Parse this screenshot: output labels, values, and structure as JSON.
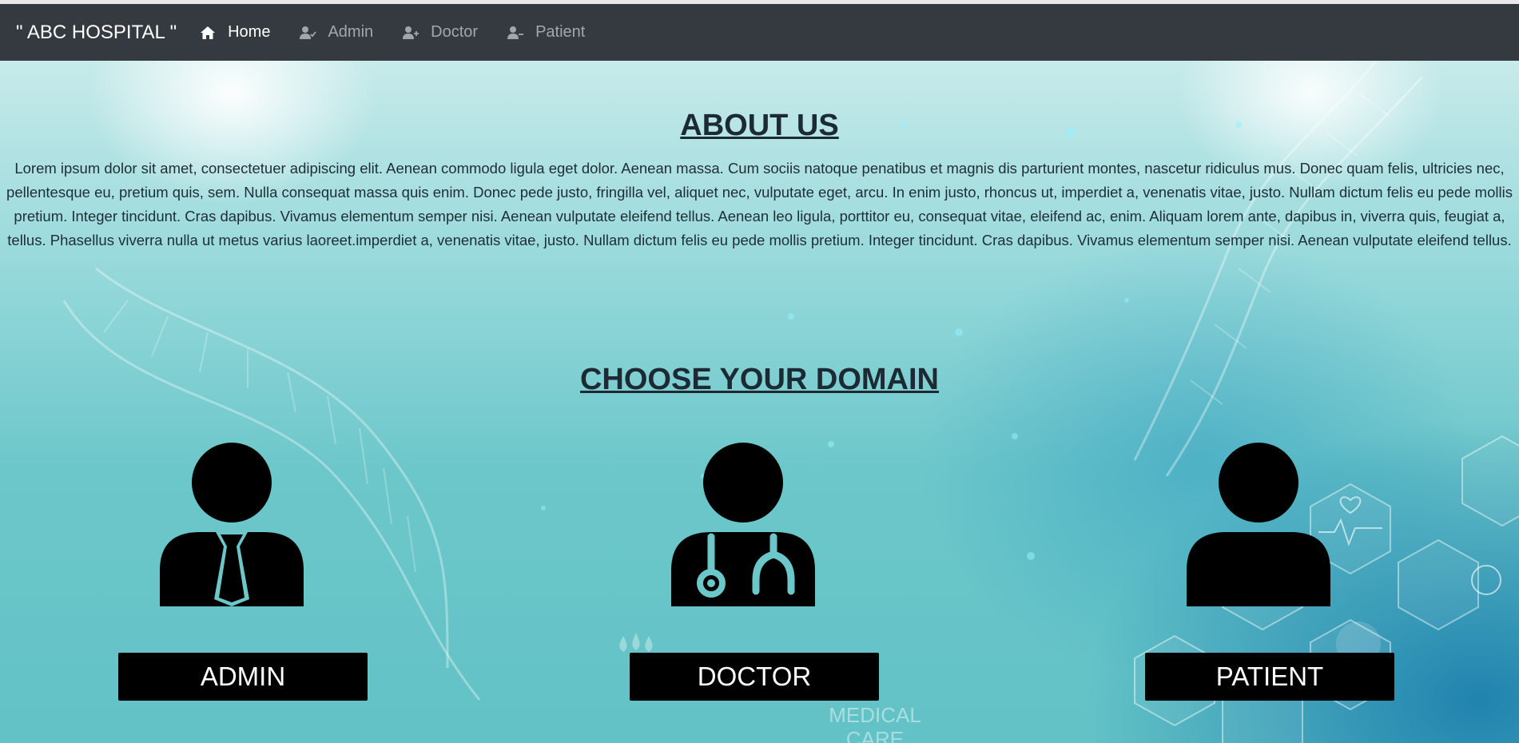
{
  "navbar": {
    "brand": "\" ABC HOSPITAL \"",
    "items": [
      {
        "label": "Home",
        "icon": "home-icon",
        "active": true
      },
      {
        "label": "Admin",
        "icon": "user-check-icon",
        "active": false
      },
      {
        "label": "Doctor",
        "icon": "user-plus-icon",
        "active": false
      },
      {
        "label": "Patient",
        "icon": "user-minus-icon",
        "active": false
      }
    ]
  },
  "about": {
    "title": "ABOUT US",
    "text": "Lorem ipsum dolor sit amet, consectetuer adipiscing elit. Aenean commodo ligula eget dolor. Aenean massa. Cum sociis natoque penatibus et magnis dis parturient montes, nascetur ridiculus mus. Donec quam felis, ultricies nec, pellentesque eu, pretium quis, sem. Nulla consequat massa quis enim. Donec pede justo, fringilla vel, aliquet nec, vulputate eget, arcu. In enim justo, rhoncus ut, imperdiet a, venenatis vitae, justo. Nullam dictum felis eu pede mollis pretium. Integer tincidunt. Cras dapibus. Vivamus elementum semper nisi. Aenean vulputate eleifend tellus. Aenean leo ligula, porttitor eu, consequat vitae, eleifend ac, enim. Aliquam lorem ante, dapibus in, viverra quis, feugiat a, tellus. Phasellus viverra nulla ut metus varius laoreet.imperdiet a, venenatis vitae, justo. Nullam dictum felis eu pede mollis pretium. Integer tincidunt. Cras dapibus. Vivamus elementum semper nisi. Aenean vulputate eleifend tellus."
  },
  "domain": {
    "title": "CHOOSE YOUR DOMAIN",
    "cards": [
      {
        "label": "ADMIN",
        "icon": "admin-person-tie-icon"
      },
      {
        "label": "DOCTOR",
        "icon": "doctor-stethoscope-icon"
      },
      {
        "label": "PATIENT",
        "icon": "patient-person-icon"
      }
    ]
  },
  "background": {
    "watermark_text": "MEDICAL CARE"
  },
  "colors": {
    "navbar_bg": "#343a40",
    "heading": "#1c2a33",
    "button_bg": "#000000",
    "button_text": "#ffffff"
  }
}
